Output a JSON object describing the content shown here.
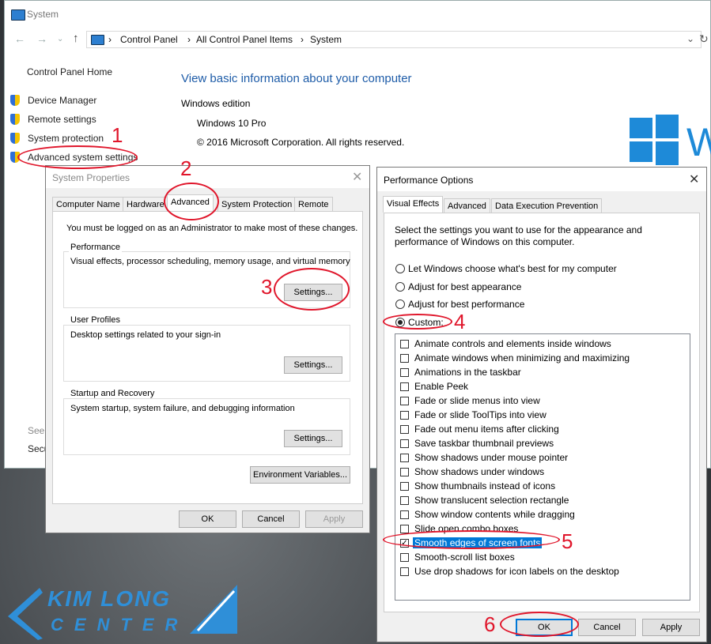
{
  "system_window": {
    "title": "System",
    "address": [
      "Control Panel",
      "All Control Panel Items",
      "System"
    ],
    "sidebar": {
      "home": "Control Panel Home",
      "items": [
        "Device Manager",
        "Remote settings",
        "System protection",
        "Advanced system settings"
      ],
      "see_also_partial": "See a",
      "security_partial": "Secu"
    },
    "heading": "View basic information about your computer",
    "edition_label": "Windows edition",
    "edition": "Windows 10 Pro",
    "copyright": "© 2016 Microsoft Corporation. All rights reserved.",
    "colors": {
      "accent": "#1e5ca8",
      "logo": "#1e8ad8"
    }
  },
  "system_properties": {
    "title": "System Properties",
    "tabs": [
      "Computer Name",
      "Hardware",
      "Advanced",
      "System Protection",
      "Remote"
    ],
    "selected_tab": "Advanced",
    "admin_note": "You must be logged on as an Administrator to make most of these changes.",
    "groups": [
      {
        "label": "Performance",
        "desc": "Visual effects, processor scheduling, memory usage, and virtual memory",
        "button": "Settings..."
      },
      {
        "label": "User Profiles",
        "desc": "Desktop settings related to your sign-in",
        "button": "Settings..."
      },
      {
        "label": "Startup and Recovery",
        "desc": "System startup, system failure, and debugging information",
        "button": "Settings..."
      }
    ],
    "env_button": "Environment Variables...",
    "ok": "OK",
    "cancel": "Cancel",
    "apply": "Apply"
  },
  "performance_options": {
    "title": "Performance Options",
    "tabs": [
      "Visual Effects",
      "Advanced",
      "Data Execution Prevention"
    ],
    "intro": "Select the settings you want to use for the appearance and performance of Windows on this computer.",
    "radios": [
      "Let Windows choose what's best for my computer",
      "Adjust for best appearance",
      "Adjust for best performance",
      "Custom:"
    ],
    "selected_radio": 3,
    "checkboxes": [
      {
        "label": "Animate controls and elements inside windows",
        "checked": false
      },
      {
        "label": "Animate windows when minimizing and maximizing",
        "checked": false
      },
      {
        "label": "Animations in the taskbar",
        "checked": false
      },
      {
        "label": "Enable Peek",
        "checked": false
      },
      {
        "label": "Fade or slide menus into view",
        "checked": false
      },
      {
        "label": "Fade or slide ToolTips into view",
        "checked": false
      },
      {
        "label": "Fade out menu items after clicking",
        "checked": false
      },
      {
        "label": "Save taskbar thumbnail previews",
        "checked": false
      },
      {
        "label": "Show shadows under mouse pointer",
        "checked": false
      },
      {
        "label": "Show shadows under windows",
        "checked": false
      },
      {
        "label": "Show thumbnails instead of icons",
        "checked": false
      },
      {
        "label": "Show translucent selection rectangle",
        "checked": false
      },
      {
        "label": "Show window contents while dragging",
        "checked": false
      },
      {
        "label": "Slide open combo boxes",
        "checked": false
      },
      {
        "label": "Smooth edges of screen fonts",
        "checked": true
      },
      {
        "label": "Smooth-scroll list boxes",
        "checked": false
      },
      {
        "label": "Use drop shadows for icon labels on the desktop",
        "checked": false
      }
    ],
    "ok": "OK",
    "cancel": "Cancel",
    "apply": "Apply"
  },
  "annotations": {
    "numbers": [
      "1",
      "2",
      "3",
      "4",
      "5",
      "6"
    ],
    "color": "#e0162b"
  },
  "watermark": {
    "line1": "KIM LONG",
    "line2": "CENTER"
  }
}
